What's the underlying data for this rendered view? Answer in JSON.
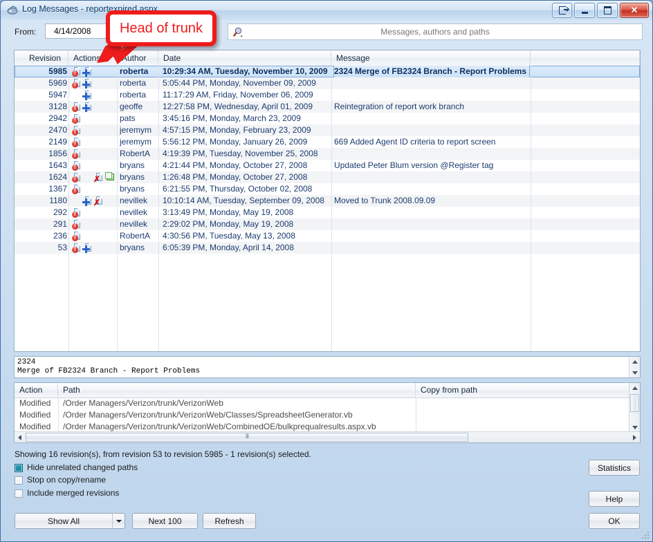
{
  "window": {
    "title": "Log Messages - reportexpired.aspx",
    "icon": "tortoisesvn-icon",
    "buttons": {
      "help": "?",
      "minimize": "–",
      "maximize": "□",
      "close": "✕"
    }
  },
  "toolbar": {
    "from_label": "From:",
    "from_value": "4/14/2008",
    "search_placeholder": "Messages, authors and paths",
    "search_value": ""
  },
  "log_list": {
    "columns": [
      "Revision",
      "Actions",
      "Author",
      "Date",
      "Message",
      ""
    ],
    "rows": [
      {
        "revision": "5985",
        "actions": [
          "modified",
          "added"
        ],
        "author": "roberta",
        "date": "10:29:34 AM, Tuesday, November 10, 2009",
        "message": "2324 Merge of FB2324 Branch - Report Problems",
        "selected": true
      },
      {
        "revision": "5969",
        "actions": [
          "modified",
          "added"
        ],
        "author": "roberta",
        "date": "5:05:44 PM, Monday, November 09, 2009",
        "message": ""
      },
      {
        "revision": "5947",
        "actions": [
          "added"
        ],
        "author": "roberta",
        "date": "11:17:29 AM, Friday, November 06, 2009",
        "message": ""
      },
      {
        "revision": "3128",
        "actions": [
          "modified",
          "added"
        ],
        "author": "geoffe",
        "date": "12:27:58 PM, Wednesday, April 01, 2009",
        "message": "Reintegration of report work branch"
      },
      {
        "revision": "2942",
        "actions": [
          "modified"
        ],
        "author": "pats",
        "date": "3:45:16 PM, Monday, March 23, 2009",
        "message": ""
      },
      {
        "revision": "2470",
        "actions": [
          "modified"
        ],
        "author": "jeremym",
        "date": "4:57:15 PM, Monday, February 23, 2009",
        "message": ""
      },
      {
        "revision": "2149",
        "actions": [
          "modified"
        ],
        "author": "jeremym",
        "date": "5:56:12 PM, Monday, January 26, 2009",
        "message": "669 Added Agent ID criteria to report screen"
      },
      {
        "revision": "1856",
        "actions": [
          "modified"
        ],
        "author": "RobertA",
        "date": "4:19:39 PM, Tuesday, November 25, 2008",
        "message": ""
      },
      {
        "revision": "1643",
        "actions": [
          "modified"
        ],
        "author": "bryans",
        "date": "4:21:44 PM, Monday, October 27, 2008",
        "message": "Updated Peter Blum version @Register tag"
      },
      {
        "revision": "1624",
        "actions": [
          "modified",
          "deleted",
          "replaced"
        ],
        "author": "bryans",
        "date": "1:26:48 PM, Monday, October 27, 2008",
        "message": ""
      },
      {
        "revision": "1367",
        "actions": [
          "modified"
        ],
        "author": "bryans",
        "date": "6:21:55 PM, Thursday, October 02, 2008",
        "message": ""
      },
      {
        "revision": "1180",
        "actions": [
          "added",
          "deleted"
        ],
        "author": "nevillek",
        "date": "10:10:14 AM, Tuesday, September 09, 2008",
        "message": "Moved to Trunk 2008.09.09"
      },
      {
        "revision": "292",
        "actions": [
          "modified"
        ],
        "author": "nevillek",
        "date": "3:13:49 PM, Monday, May 19, 2008",
        "message": ""
      },
      {
        "revision": "291",
        "actions": [
          "modified"
        ],
        "author": "nevillek",
        "date": "2:29:02 PM, Monday, May 19, 2008",
        "message": ""
      },
      {
        "revision": "236",
        "actions": [
          "modified"
        ],
        "author": "RobertA",
        "date": "4:30:56 PM, Tuesday, May 13, 2008",
        "message": ""
      },
      {
        "revision": "53",
        "actions": [
          "modified",
          "added"
        ],
        "author": "bryans",
        "date": "6:05:39 PM, Monday, April 14, 2008",
        "message": ""
      }
    ]
  },
  "message_box": {
    "line1": "2324",
    "line2": "Merge of FB2324 Branch - Report Problems"
  },
  "paths_list": {
    "columns": [
      "Action",
      "Path",
      "Copy from path"
    ],
    "rows": [
      {
        "action": "Modified",
        "path": "/Order Managers/Verizon/trunk/VerizonWeb",
        "copy_from": ""
      },
      {
        "action": "Modified",
        "path": "/Order Managers/Verizon/trunk/VerizonWeb/Classes/SpreadsheetGenerator.vb",
        "copy_from": ""
      },
      {
        "action": "Modified",
        "path": "/Order Managers/Verizon/trunk/VerizonWeb/CombinedOE/bulkprequalresults.aspx.vb",
        "copy_from": ""
      }
    ]
  },
  "footer": {
    "status": "Showing 16 revision(s), from revision 53 to revision 5985 - 1 revision(s) selected.",
    "checkboxes": [
      {
        "label": "Hide unrelated changed paths",
        "checked": true
      },
      {
        "label": "Stop on copy/rename",
        "checked": false
      },
      {
        "label": "Include merged revisions",
        "checked": false
      }
    ],
    "buttons": {
      "show_all": "Show All",
      "show_all_accesskey": "A",
      "next_100": "Next 100",
      "refresh": "Refresh",
      "statistics": "Statistics",
      "help": "Help",
      "ok": "OK"
    }
  },
  "annotation": {
    "text": "Head of trunk",
    "color": "#ee1c1c"
  }
}
